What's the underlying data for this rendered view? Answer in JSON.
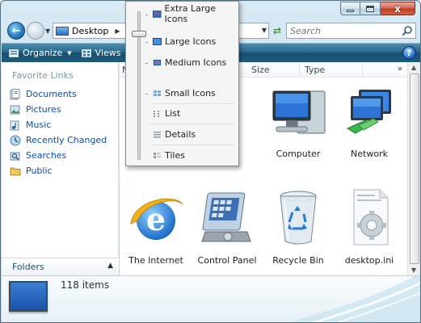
{
  "window": {
    "caption_close": "x"
  },
  "address": {
    "location": "Desktop"
  },
  "search": {
    "placeholder": "Search"
  },
  "toolbar": {
    "organize_label": "Organize",
    "views_label": "Views",
    "help_label": "?"
  },
  "sidebar": {
    "title": "Favorite Links",
    "items": [
      {
        "label": "Documents",
        "icon": "documents-icon"
      },
      {
        "label": "Pictures",
        "icon": "pictures-icon"
      },
      {
        "label": "Music",
        "icon": "music-icon"
      },
      {
        "label": "Recently Changed",
        "icon": "recently-changed-icon"
      },
      {
        "label": "Searches",
        "icon": "searches-icon"
      },
      {
        "label": "Public",
        "icon": "public-folder-icon"
      }
    ],
    "folders_label": "Folders"
  },
  "columns": {
    "name_partial": "N",
    "size": "Size",
    "type": "Type",
    "more": "»"
  },
  "items": [
    {
      "label": "Computer",
      "icon": "computer-icon"
    },
    {
      "label": "Network",
      "icon": "network-icon"
    },
    {
      "label": "The Internet",
      "icon": "internet-explorer-icon"
    },
    {
      "label": "Control Panel",
      "icon": "control-panel-icon"
    },
    {
      "label": "Recycle Bin",
      "icon": "recycle-bin-icon"
    },
    {
      "label": "desktop.ini",
      "icon": "settings-file-icon"
    }
  ],
  "views_menu": {
    "selected": "Large Icons",
    "items": [
      "Extra Large Icons",
      "Large Icons",
      "Medium Icons",
      "Small Icons",
      "List",
      "Details",
      "Tiles"
    ]
  },
  "details_pane": {
    "count": "118 items"
  }
}
